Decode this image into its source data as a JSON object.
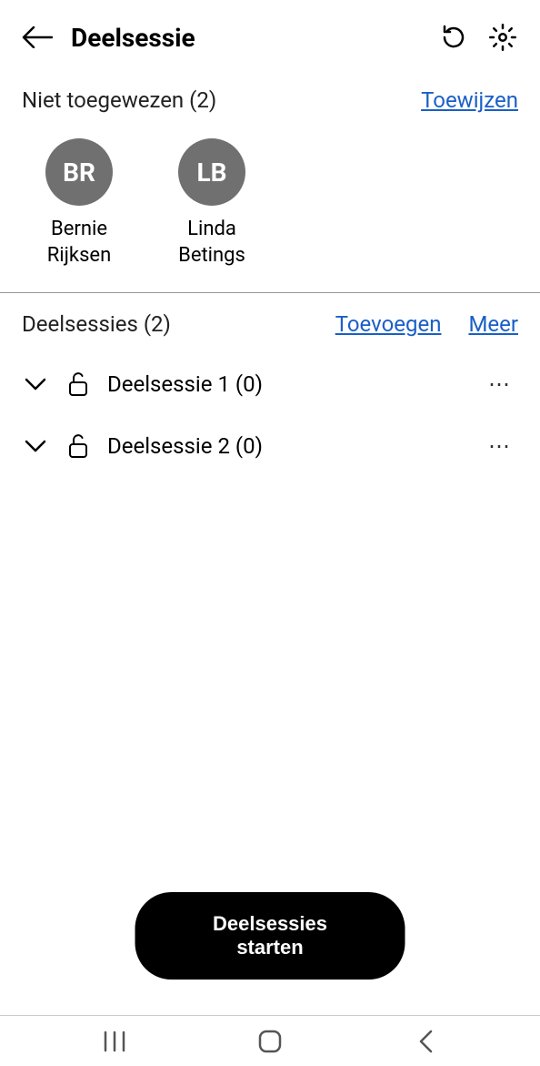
{
  "header": {
    "title": "Deelsessie"
  },
  "unassigned": {
    "title": "Niet toegewezen (2)",
    "assign_link": "Toewijzen",
    "people": [
      {
        "initials": "BR",
        "name": "Bernie Rijksen"
      },
      {
        "initials": "LB",
        "name": "Linda Betings"
      }
    ]
  },
  "sessions": {
    "title": "Deelsessies (2)",
    "add_link": "Toevoegen",
    "more_link": "Meer",
    "rooms": [
      {
        "name": "Deelsessie 1 (0)"
      },
      {
        "name": "Deelsessie 2 (0)"
      }
    ]
  },
  "actions": {
    "start_label": "Deelsessies starten"
  }
}
